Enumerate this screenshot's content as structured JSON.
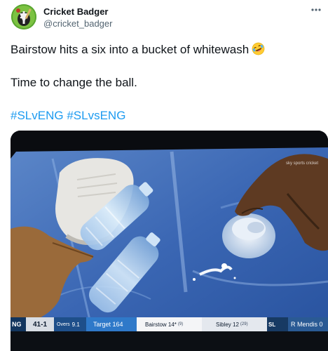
{
  "author": {
    "name": "Cricket Badger",
    "handle": "@cricket_badger",
    "avatar_icon": "badger-avatar-icon"
  },
  "tweet": {
    "line1": "Bairstow hits a six into a bucket of whitewash",
    "line1_emoji": "rolling-on-floor-laughing-emoji",
    "line2": "Time to change the ball.",
    "hashtags": [
      "#SLvENG",
      "#SLvsENG"
    ]
  },
  "media": {
    "channel_logo": "sky sports cricket",
    "scorebar": {
      "batting_team": "NG",
      "score": "41-1",
      "overs_label": "Overs",
      "overs": "9.1",
      "target": "Target 164",
      "batter1_name": "Bairstow 14*",
      "batter1_balls": "(9)",
      "batter2_name": "Sibley 12",
      "batter2_balls": "(29)",
      "bowling_team": "SL",
      "bowler": "R Mendis 0"
    }
  },
  "colors": {
    "hashtag": "#1d9bf0",
    "handle": "#536471",
    "text": "#0f1419"
  }
}
